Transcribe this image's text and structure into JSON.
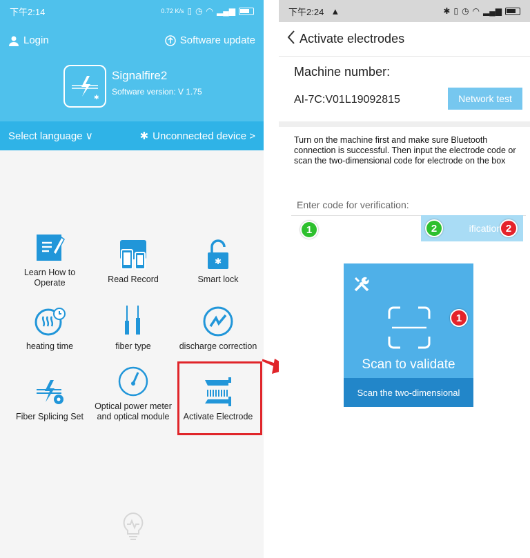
{
  "left": {
    "status": {
      "time": "下午2:14",
      "net": "0.72 K/s"
    },
    "header": {
      "login_label": "Login",
      "update_label": "Software update",
      "brand": "Signalfire2",
      "version": "Software version: V 1.75"
    },
    "langbar": {
      "language_label": "Select language ∨",
      "device_label": "Unconnected device  >"
    },
    "grid": [
      {
        "label": "Learn How to Operate"
      },
      {
        "label": "Read Record"
      },
      {
        "label": "Smart lock"
      },
      {
        "label": "heating time"
      },
      {
        "label": "fiber type"
      },
      {
        "label": "discharge correction"
      },
      {
        "label": "Fiber Splicing Set"
      },
      {
        "label": "Optical power meter and optical module"
      },
      {
        "label": "Activate Electrode"
      }
    ]
  },
  "right": {
    "status": {
      "time": "下午2:24"
    },
    "title": "Activate electrodes",
    "machine_label": "Machine number:",
    "machine_number": "AI-7C:V01L19092815",
    "network_test_label": "Network test",
    "instructions": "Turn on the machine first and make sure Bluetooth connection is successful. Then input the electrode code or scan the two-dimensional code for electrode on the box",
    "verify_placeholder": "Enter code for verification:",
    "verify_button_label": "ification c",
    "badges": {
      "input": "1",
      "button_left": "2",
      "button_right": "2",
      "scan": "1"
    },
    "scan": {
      "label": "Scan to validate",
      "footer": "Scan the two-dimensional"
    }
  },
  "colors": {
    "header_blue": "#4fc1ec",
    "langbar_blue": "#2fb3e7",
    "icon_blue": "#2196d9",
    "highlight_red": "#e0252a",
    "badge_green": "#2ec02e",
    "badge_red": "#e5232a"
  }
}
